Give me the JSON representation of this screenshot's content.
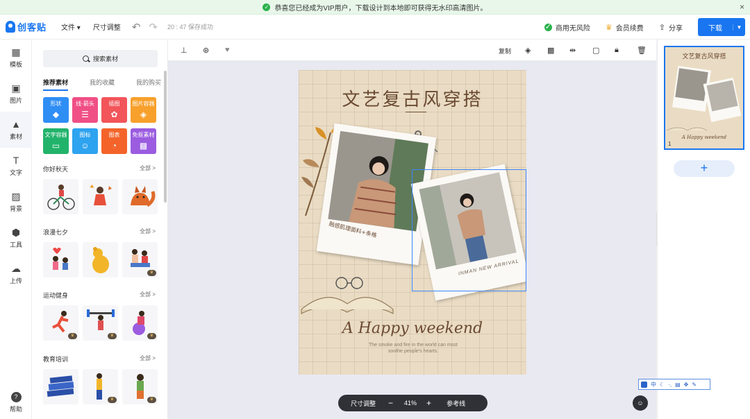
{
  "banner": {
    "message": "恭喜您已经成为VIP用户，下载设计到本地即可获得无水印高清图片。",
    "close": "×"
  },
  "header": {
    "logo": "创客贴",
    "menu_file": "文件 ▾",
    "menu_resize": "尺寸调整",
    "save_status": "20 : 47 保存成功",
    "commercial": "商用无风险",
    "membership": "会员续费",
    "share": "分享",
    "download": "下载"
  },
  "rail": [
    {
      "label": "模板",
      "icon": "▦"
    },
    {
      "label": "图片",
      "icon": "▣"
    },
    {
      "label": "素材",
      "icon": "▲"
    },
    {
      "label": "文字",
      "icon": "T"
    },
    {
      "label": "背景",
      "icon": "▨"
    },
    {
      "label": "工具",
      "icon": "⬢"
    },
    {
      "label": "上传",
      "icon": "☁"
    }
  ],
  "help": {
    "label": "帮助",
    "icon": "?"
  },
  "panel": {
    "search": "搜索素材",
    "tabs": [
      "推荐素材",
      "我的收藏",
      "我的购买"
    ],
    "categories": [
      {
        "label": "形状",
        "color": "#2f8ef4",
        "glyph": "◆"
      },
      {
        "label": "线·箭头",
        "color": "#f04f86",
        "glyph": "☰"
      },
      {
        "label": "插图",
        "color": "#f2555a",
        "glyph": "✿"
      },
      {
        "label": "图片容器",
        "color": "#f7a02c",
        "glyph": "◈"
      },
      {
        "label": "文字容器",
        "color": "#22b36b",
        "glyph": "▭"
      },
      {
        "label": "图标",
        "color": "#2ea3ef",
        "glyph": "☺"
      },
      {
        "label": "图表",
        "color": "#f4642a",
        "glyph": "◔"
      },
      {
        "label": "免抠素材",
        "color": "#9b5ce0",
        "glyph": "▩"
      }
    ],
    "sections": [
      {
        "title": "你好秋天",
        "more": "全部 >"
      },
      {
        "title": "浪漫七夕",
        "more": "全部 >"
      },
      {
        "title": "运动健身",
        "more": "全部 >"
      },
      {
        "title": "教育培训",
        "more": "全部 >"
      }
    ],
    "vip_badge": "♛"
  },
  "toolbar": {
    "copy": "复制"
  },
  "poster": {
    "title": "文艺复古风穿搭",
    "caption1": "融感肌理面料+条格",
    "caption2": "INMAN NEW ARRIVAL",
    "happy": "A Happy weekend",
    "sub": "The smoke and fire in the world can most soothe people's hearts."
  },
  "zoombar": {
    "resize": "尺寸调整",
    "minus": "−",
    "zoom": "41%",
    "plus": "+",
    "guide": "参考线"
  },
  "pages": {
    "page_number": "1",
    "add": "+"
  },
  "ime": {
    "label": "中"
  }
}
